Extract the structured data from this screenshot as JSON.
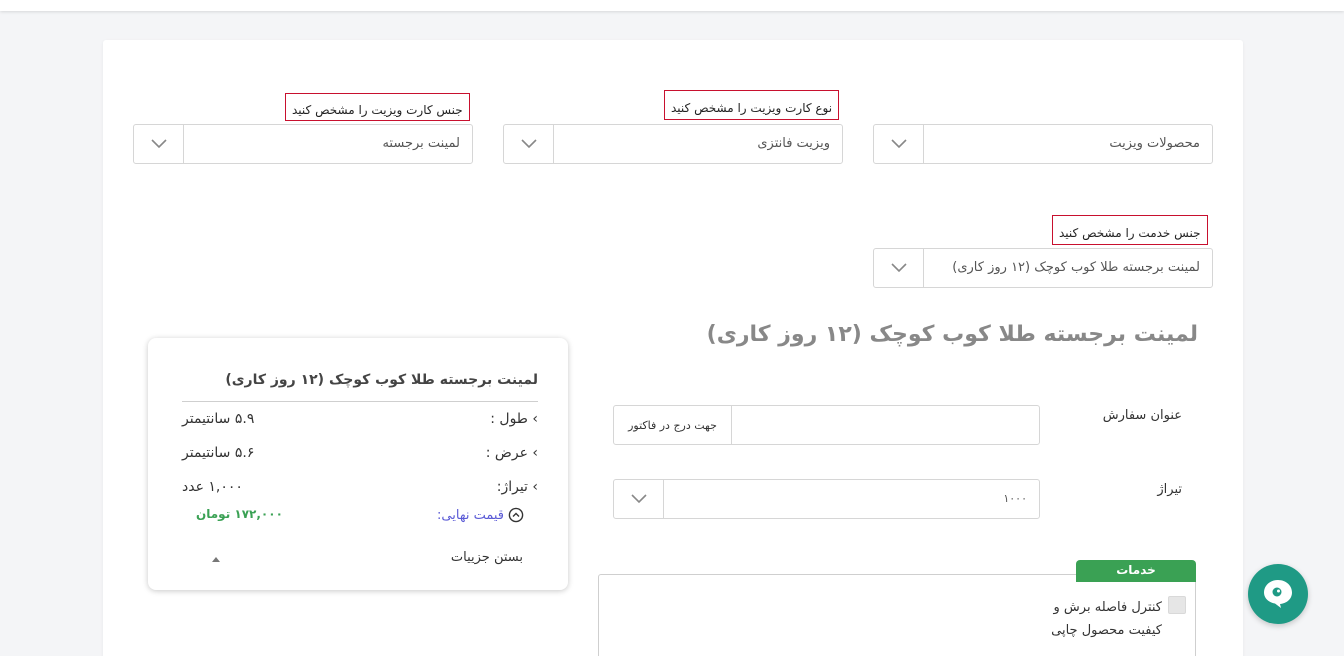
{
  "form": {
    "product_category": {
      "value": "محصولات ویزیت"
    },
    "card_type": {
      "label": "نوع کارت ویزیت را مشخص کنید",
      "value": "ویزیت فانتزی"
    },
    "card_material": {
      "label": "جنس کارت ویزیت را مشخص کنید",
      "value": "لمینت برجسته"
    },
    "service_type": {
      "label": "جنس خدمت را مشخص کنید",
      "value": "لمینت برجسته طلا کوب کوچک (۱۲ روز کاری)"
    },
    "heading": "لمینت برجسته طلا کوب کوچک (۱۲ روز کاری)",
    "order_title": {
      "label": "عنوان سفارش",
      "value": "",
      "addon": "جهت درج در فاکتور"
    },
    "quantity": {
      "label": "تیراژ",
      "value": "۱۰۰۰"
    }
  },
  "summary": {
    "title": "لمینت برجسته طلا کوب کوچک (۱۲ روز کاری)",
    "length": {
      "key": "› طول :",
      "value": "۵.۹ سانتیمتر"
    },
    "width": {
      "key": "› عرض :",
      "value": "۵.۶ سانتیمتر"
    },
    "quantity": {
      "key": "› تیراژ:",
      "value": "۱,۰۰۰ عدد"
    },
    "final_price": {
      "key": "قیمت نهایی:",
      "value": "۱۷۲,۰۰۰ تومان"
    },
    "close_details": "بستن جزییات"
  },
  "services": {
    "tab": "خدمات",
    "item": "کنترل فاصله برش و کیفیت محصول چاپی"
  },
  "icons": {
    "dropdown": "chevron-down-icon",
    "price": "chevron-up-circle-icon",
    "collapse": "caret-up-icon",
    "chat": "chat-bubble-icon"
  },
  "colors": {
    "label_border": "#c8102e",
    "accent_green": "#3aa154",
    "price_key": "#5b5bd6",
    "chat_teal": "#1f9a85"
  }
}
